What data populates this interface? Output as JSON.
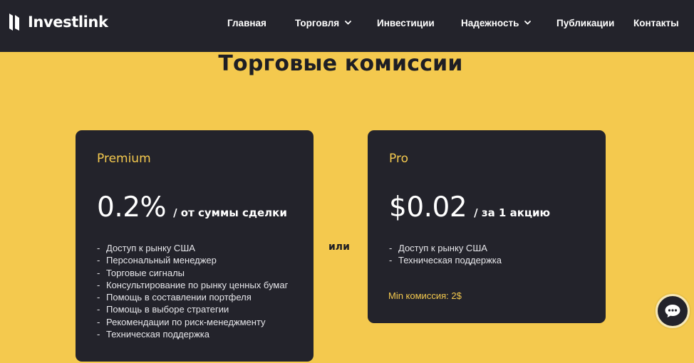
{
  "header": {
    "brand": "Investlink",
    "nav": {
      "home": "Главная",
      "trading": "Торговля",
      "investments": "Инвестиции",
      "reliability": "Надежность",
      "publications": "Публикации",
      "contacts": "Контакты"
    }
  },
  "main": {
    "title": "Торговые комиссии",
    "or_label": "или",
    "plans": {
      "premium": {
        "name": "Premium",
        "price": "0.2%",
        "price_suffix": "/ от суммы сделки",
        "features": [
          "Доступ к рынку США",
          "Персональный менеджер",
          "Торговые сигналы",
          "Консультирование по рынку ценных бумаг",
          "Помощь в составлении портфеля",
          "Помощь в выборе стратегии",
          "Рекомендации по риск-менеджменту",
          "Техническая поддержка"
        ]
      },
      "pro": {
        "name": "Pro",
        "price": "$0.02",
        "price_suffix": "/ за 1 акцию",
        "features": [
          "Доступ к рынку США",
          "Техническая поддержка"
        ],
        "min_commission": "Min комиссия: 2$"
      }
    }
  },
  "colors": {
    "background": "#f4c94e",
    "dark": "#23232b",
    "accent": "#f4c94e"
  },
  "icons": {
    "brand_mark": "investlink-logo-mark",
    "dropdown": "chevron-down-icon",
    "chat": "chat-bubble-icon"
  }
}
